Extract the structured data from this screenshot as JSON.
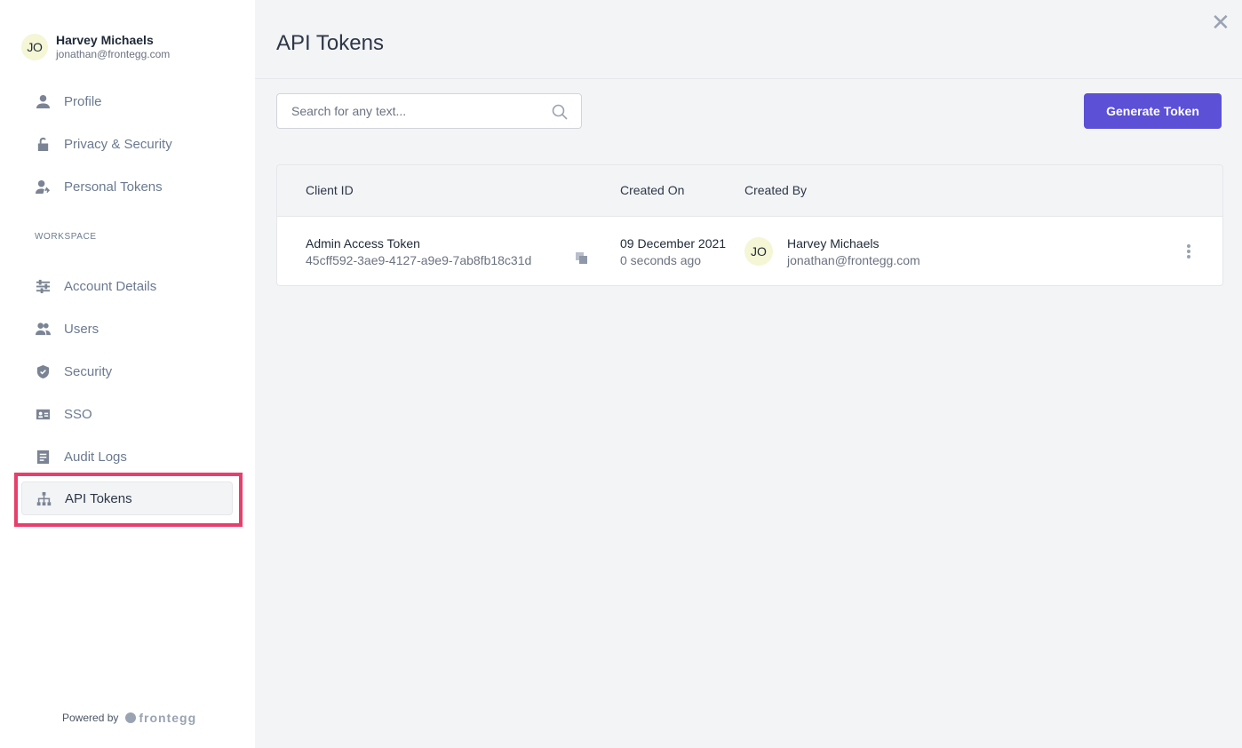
{
  "user": {
    "initials": "JO",
    "name": "Harvey Michaels",
    "email": "jonathan@frontegg.com"
  },
  "nav": {
    "personal": [
      {
        "label": "Profile",
        "icon": "person-icon"
      },
      {
        "label": "Privacy & Security",
        "icon": "lock-icon"
      },
      {
        "label": "Personal Tokens",
        "icon": "person-key-icon"
      }
    ],
    "section_title": "WORKSPACE",
    "workspace": [
      {
        "label": "Account Details",
        "icon": "sliders-icon"
      },
      {
        "label": "Users",
        "icon": "users-icon"
      },
      {
        "label": "Security",
        "icon": "shield-icon"
      },
      {
        "label": "SSO",
        "icon": "id-card-icon"
      },
      {
        "label": "Audit Logs",
        "icon": "document-icon"
      },
      {
        "label": "API Tokens",
        "icon": "hierarchy-icon",
        "active": true
      }
    ]
  },
  "footer": {
    "powered_by": "Powered by",
    "brand": "frontegg"
  },
  "main": {
    "title": "API Tokens",
    "search": {
      "placeholder": "Search for any text...",
      "value": ""
    },
    "generate_button": "Generate Token"
  },
  "table": {
    "columns": [
      "Client ID",
      "Created On",
      "Created By"
    ],
    "rows": [
      {
        "name": "Admin Access Token",
        "client_id": "45cff592-3ae9-4127-a9e9-7ab8fb18c31d",
        "created_date": "09 December 2021",
        "created_ago": "0 seconds ago",
        "creator_initials": "JO",
        "creator_name": "Harvey Michaels",
        "creator_email": "jonathan@frontegg.com"
      }
    ]
  },
  "colors": {
    "accent": "#5b50d6",
    "highlight": "#e83e6c",
    "avatar_bg": "#f4f6d5"
  }
}
